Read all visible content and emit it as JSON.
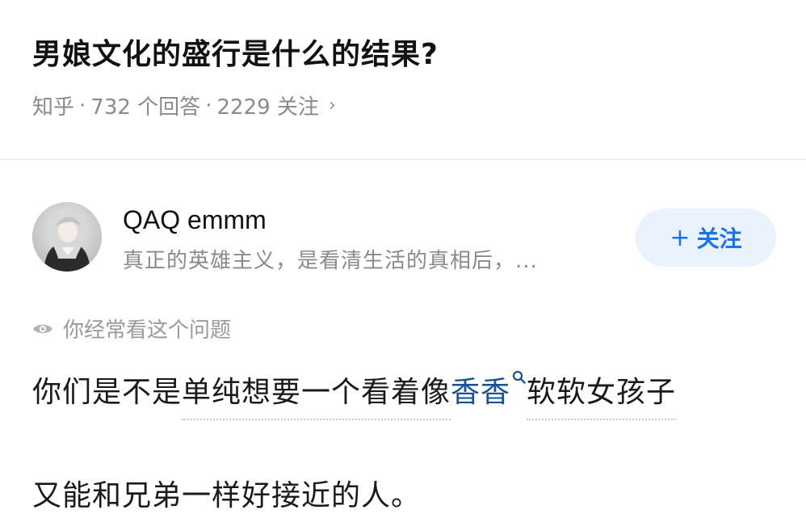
{
  "question": {
    "title": "男娘文化的盛行是什么的结果?",
    "platform": "知乎",
    "answers": "732 个回答",
    "followers": "2229 关注",
    "separator": "·",
    "chevron": "›"
  },
  "author": {
    "name": "QAQ emmm",
    "bio": "真正的英雄主义，是看清生活的真相后，...",
    "follow_plus": "+",
    "follow_label": "关注"
  },
  "viewed_hint": "你经常看这个问题",
  "answer": {
    "line1_pre": "你们是不是",
    "line1_dotted": "单纯想要一个看着像",
    "line1_link": "香香",
    "line1_post": "软软女孩子",
    "line2": "又能和兄弟一样好接近的人。"
  },
  "colors": {
    "accent": "#1772f6",
    "follow_bg": "#eaf2fd",
    "link": "#175199",
    "meta": "#8a8a8a"
  },
  "icons": {
    "viewed": "eye-icon",
    "search_link": "search-icon"
  }
}
